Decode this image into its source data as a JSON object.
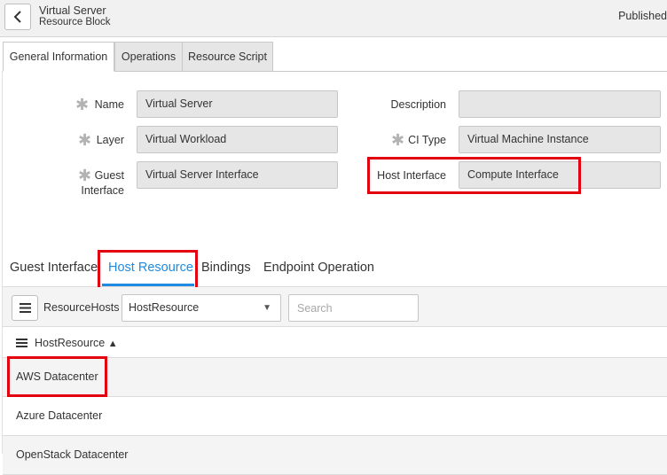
{
  "header": {
    "title": "Virtual Server",
    "subtitle": "Resource Block",
    "status": "Published"
  },
  "form_tabs": [
    {
      "label": "General Information"
    },
    {
      "label": "Operations"
    },
    {
      "label": "Resource Script"
    }
  ],
  "form": {
    "name": {
      "label": "Name",
      "value": "Virtual Server"
    },
    "layer": {
      "label": "Layer",
      "value": "Virtual Workload"
    },
    "guest_interface": {
      "label_line1": "Guest",
      "label_line2": "Interface",
      "value": "Virtual Server Interface"
    },
    "description": {
      "label": "Description",
      "value": ""
    },
    "ci_type": {
      "label": "CI Type",
      "value": "Virtual Machine Instance"
    },
    "host_interface": {
      "label": "Host Interface",
      "value": "Compute Interface"
    }
  },
  "related_tabs": [
    {
      "label": "Guest Interface"
    },
    {
      "label": "Host Resource"
    },
    {
      "label": "Bindings"
    },
    {
      "label": "Endpoint Operation"
    }
  ],
  "list": {
    "title": "ResourceHosts",
    "select_value": "HostResource",
    "search_placeholder": "Search",
    "column": "HostResource",
    "sort_indicator": "▲",
    "rows": [
      {
        "label": "AWS Datacenter"
      },
      {
        "label": "Azure Datacenter"
      },
      {
        "label": "OpenStack Datacenter"
      }
    ]
  },
  "colors": {
    "highlight": "#e3000f",
    "accent": "#1f8ae0"
  },
  "icons": [
    "chevron-left-icon",
    "required-asterisk-icon",
    "hamburger-menu-icon",
    "caret-down-icon",
    "sort-ascending-icon"
  ]
}
